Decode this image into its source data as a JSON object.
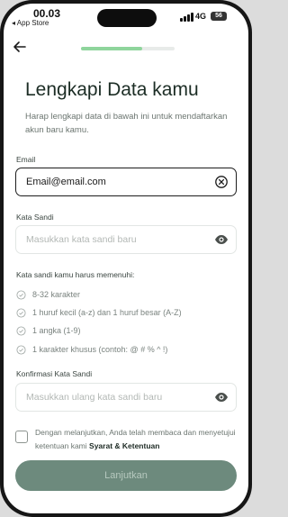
{
  "status_bar": {
    "time": "00.03",
    "back_app": "◂ App Store",
    "network": "4G",
    "battery": "56"
  },
  "progress": {
    "fraction": 0.65
  },
  "header": {
    "title": "Lengkapi Data kamu",
    "subtitle": "Harap lengkapi data di bawah ini untuk mendaftarkan akun baru kamu."
  },
  "form": {
    "email": {
      "label": "Email",
      "value": "Email@email.com"
    },
    "password": {
      "label": "Kata Sandi",
      "placeholder": "Masukkan kata sandi baru"
    },
    "requirements": {
      "title": "Kata sandi kamu harus memenuhi:",
      "items": [
        "8-32 karakter",
        "1 huruf kecil (a-z) dan 1 huruf besar (A-Z)",
        "1 angka (1-9)",
        "1 karakter khusus (contoh: @ # % ^ !)"
      ]
    },
    "confirm_password": {
      "label": "Konfirmasi Kata Sandi",
      "placeholder": "Masukkan ulang kata sandi baru"
    }
  },
  "consent": {
    "text": "Dengan melanjutkan, Anda telah membaca dan menyetujui ketentuan kami",
    "link": "Syarat & Ketentuan"
  },
  "submit_label": "Lanjutkan",
  "colors": {
    "accent": "#8fd59c",
    "button": "#6d8a7d",
    "title": "#1c2d25"
  }
}
